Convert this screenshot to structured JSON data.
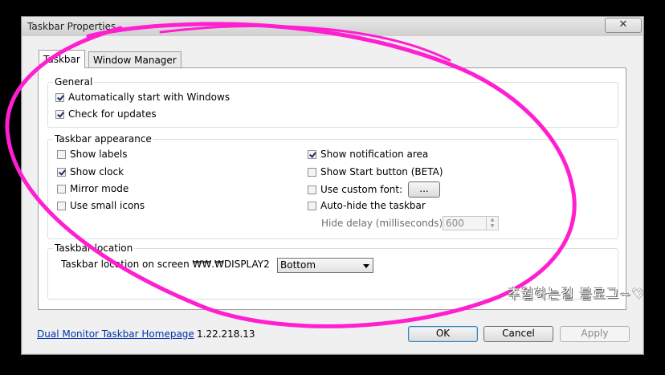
{
  "window": {
    "title": "Taskbar Properties",
    "close_glyph": "✕"
  },
  "tabs": [
    {
      "label": "Taskbar",
      "active": true
    },
    {
      "label": "Window Manager",
      "active": false
    }
  ],
  "general": {
    "title": "General",
    "items": [
      {
        "label": "Automatically start with Windows",
        "checked": true
      },
      {
        "label": "Check for updates",
        "checked": true
      }
    ]
  },
  "appearance": {
    "title": "Taskbar appearance",
    "left": [
      {
        "label": "Show labels",
        "checked": false
      },
      {
        "label": "Show clock",
        "checked": true
      },
      {
        "label": "Mirror mode",
        "checked": false
      },
      {
        "label": "Use small icons",
        "checked": false
      }
    ],
    "right": [
      {
        "label": "Show notification area",
        "checked": true
      },
      {
        "label": "Show Start button (BETA)",
        "checked": false
      },
      {
        "label": "Use custom font:",
        "checked": false
      },
      {
        "label": "Auto-hide the taskbar",
        "checked": false
      }
    ],
    "font_button": "...",
    "hide_delay_label": "Hide delay (milliseconds):",
    "hide_delay_value": "600"
  },
  "location": {
    "title": "Taskbar location",
    "screen_label": "Taskbar location on screen ₩₩.₩DISPLAY2",
    "selected": "Bottom"
  },
  "footer": {
    "homepage_link": "Dual Monitor Taskbar Homepage",
    "version": "1.22.218.13",
    "ok": "OK",
    "cancel": "Cancel",
    "apply": "Apply"
  },
  "watermark": "추월하는길 블로그~♡",
  "colors": {
    "annotation": "#ff1fd0",
    "link": "#0033aa",
    "accent": "#3c7fb1"
  }
}
